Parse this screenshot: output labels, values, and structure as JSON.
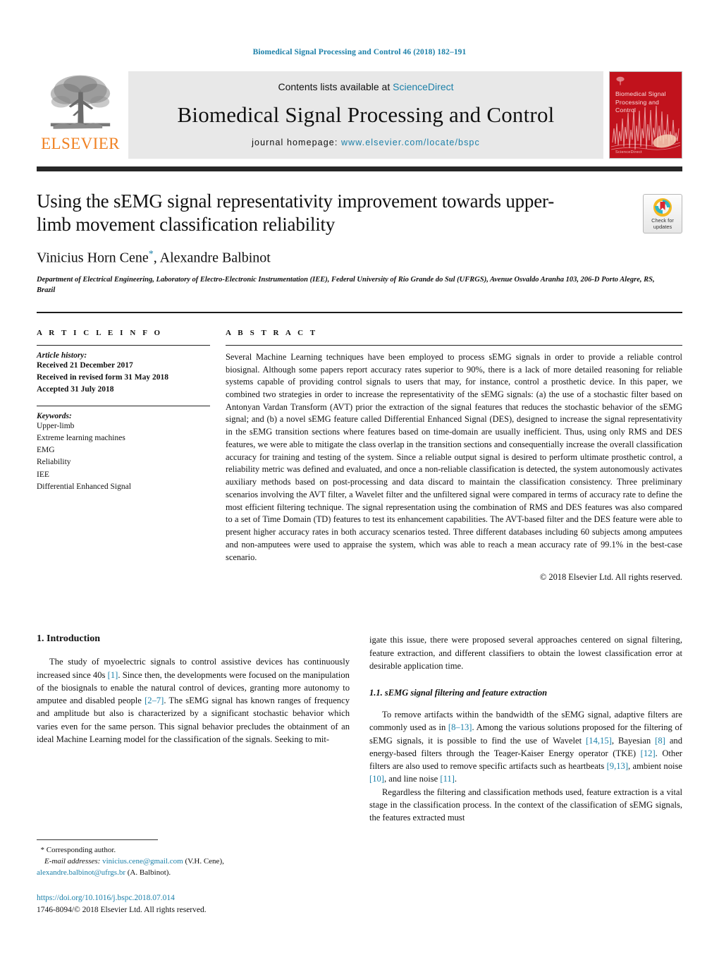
{
  "running_head": "Biomedical Signal Processing and Control 46 (2018) 182–191",
  "masthead": {
    "publisher_name": "ELSEVIER",
    "contents_prefix": "Contents lists available at ",
    "contents_link": "ScienceDirect",
    "journal_title": "Biomedical Signal Processing and Control",
    "homepage_prefix": "journal homepage: ",
    "homepage_url": "www.elsevier.com/locate/bspc",
    "cover_title": "Biomedical Signal Processing and Control",
    "cover_footer": "ScienceDirect"
  },
  "title_block": {
    "title": "Using the sEMG signal representativity improvement towards upper-limb movement classification reliability",
    "authors_part1": "Vinicius Horn Cene",
    "corresponding_marker": "*",
    "authors_part2": ", Alexandre Balbinot",
    "affiliation": "Department of Electrical Engineering, Laboratory of Electro-Electronic Instrumentation (IEE), Federal University of Rio Grande do Sul (UFRGS), Avenue Osvaldo Aranha 103, 206-D Porto Alegre, RS, Brazil",
    "crossmark_label": "Check for updates"
  },
  "article_info": {
    "heading": "A R T I C L E   I N F O",
    "history_label": "Article history:",
    "history": [
      "Received 21 December 2017",
      "Received in revised form 31 May 2018",
      "Accepted 31 July 2018"
    ],
    "keywords_label": "Keywords:",
    "keywords": [
      "Upper-limb",
      "Extreme learning machines",
      "EMG",
      "Reliability",
      "IEE",
      "Differential Enhanced Signal"
    ]
  },
  "abstract": {
    "heading": "A B S T R A C T",
    "text": "Several Machine Learning techniques have been employed to process sEMG signals in order to provide a reliable control biosignal. Although some papers report accuracy rates superior to 90%, there is a lack of more detailed reasoning for reliable systems capable of providing control signals to users that may, for instance, control a prosthetic device. In this paper, we combined two strategies in order to increase the representativity of the sEMG signals: (a) the use of a stochastic filter based on Antonyan Vardan Transform (AVT) prior the extraction of the signal features that reduces the stochastic behavior of the sEMG signal; and (b) a novel sEMG feature called Differential Enhanced Signal (DES), designed to increase the signal representativity in the sEMG transition sections where features based on time-domain are usually inefficient. Thus, using only RMS and DES features, we were able to mitigate the class overlap in the transition sections and consequentially increase the overall classification accuracy for training and testing of the system. Since a reliable output signal is desired to perform ultimate prosthetic control, a reliability metric was defined and evaluated, and once a non-reliable classification is detected, the system autonomously activates auxiliary methods based on post-processing and data discard to maintain the classification consistency. Three preliminary scenarios involving the AVT filter, a Wavelet filter and the unfiltered signal were compared in terms of accuracy rate to define the most efficient filtering technique. The signal representation using the combination of RMS and DES features was also compared to a set of Time Domain (TD) features to test its enhancement capabilities. The AVT-based filter and the DES feature were able to present higher accuracy rates in both accuracy scenarios tested. Three different databases including 60 subjects among amputees and non-amputees were used to appraise the system, which was able to reach a mean accuracy rate of 99.1% in the best-case scenario.",
    "copyright": "© 2018 Elsevier Ltd. All rights reserved."
  },
  "body": {
    "section1_heading": "1.  Introduction",
    "left_para1_a": "The study of myoelectric signals to control assistive devices has continuously increased since 40s ",
    "left_para1_ref1": "[1]",
    "left_para1_b": ". Since then, the developments were focused on the manipulation of the biosignals to enable the natural control of devices, granting more autonomy to amputee and disabled people ",
    "left_para1_ref2": "[2–7]",
    "left_para1_c": ". The sEMG signal has known ranges of frequency and amplitude but also is characterized by a significant stochastic behavior which varies even for the same person. This signal behavior precludes the obtainment of an ideal Machine Learning model for the classification of the signals. Seeking to mit-",
    "right_para_cont": "igate this issue, there were proposed several approaches centered on signal filtering, feature extraction, and different classifiers to obtain the lowest classification error at desirable application time.",
    "section11_heading": "1.1.  sEMG signal filtering and feature extraction",
    "right_para2_a": "To remove artifacts within the bandwidth of the sEMG signal, adaptive filters are commonly used as in ",
    "right_para2_ref1": "[8–13]",
    "right_para2_b": ". Among the various solutions proposed for the filtering of sEMG signals, it is possible to find the use of Wavelet ",
    "right_para2_ref2": "[14,15]",
    "right_para2_c": ", Bayesian ",
    "right_para2_ref3": "[8]",
    "right_para2_d": " and energy-based filters through the Teager-Kaiser Energy operator (TKE) ",
    "right_para2_ref4": "[12]",
    "right_para2_e": ". Other filters are also used to remove specific artifacts such as heartbeats ",
    "right_para2_ref5": "[9,13]",
    "right_para2_f": ", ambient noise ",
    "right_para2_ref6": "[10]",
    "right_para2_g": ", and line noise ",
    "right_para2_ref7": "[11]",
    "right_para2_h": ".",
    "right_para3": "Regardless the filtering and classification methods used, feature extraction is a vital stage in the classification process. In the context of the classification of sEMG signals, the features extracted must"
  },
  "footnote": {
    "corresponding_star": "*",
    "corresponding_text": "Corresponding author.",
    "email_label": "E-mail addresses:",
    "email1": "vinicius.cene@gmail.com",
    "email1_owner": "(V.H. Cene),",
    "email2": "alexandre.balbinot@ufrgs.br",
    "email2_owner": "(A. Balbinot).",
    "doi": "https://doi.org/10.1016/j.bspc.2018.07.014",
    "issn_copyright": "1746-8094/© 2018 Elsevier Ltd. All rights reserved."
  },
  "colors": {
    "link_blue": "#1a7fa8",
    "elsevier_orange": "#f08122",
    "cover_red": "#c1121c",
    "rule_dark": "#262626"
  }
}
